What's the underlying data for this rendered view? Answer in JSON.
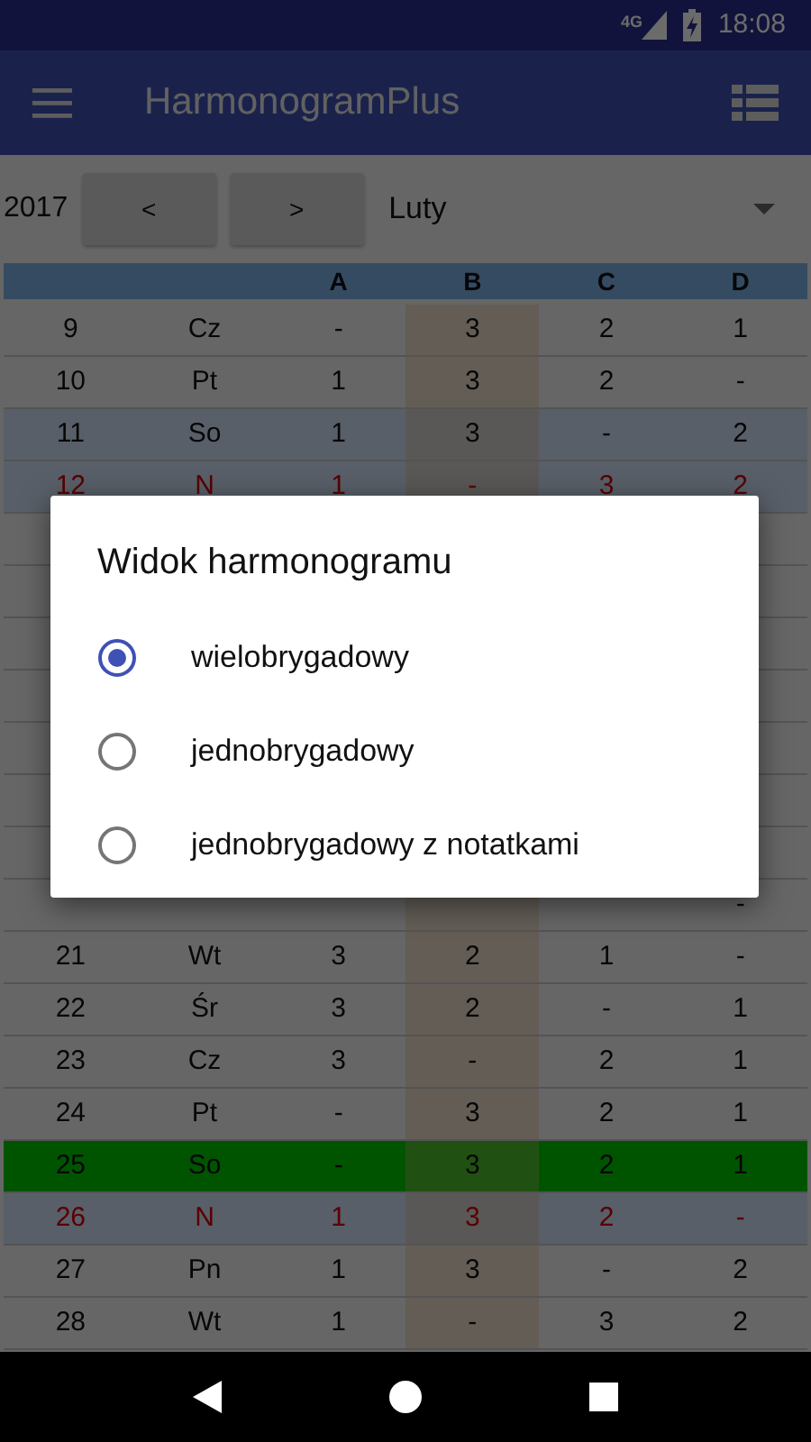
{
  "status_bar": {
    "network": "4G",
    "time": "18:08"
  },
  "app_bar": {
    "title": "HarmonogramPlus"
  },
  "controls": {
    "year": "2017",
    "prev": "<",
    "next": ">",
    "month": "Luty"
  },
  "table": {
    "columns": [
      "",
      "",
      "A",
      "B",
      "C",
      "D"
    ],
    "rows": [
      {
        "kind": "weekday",
        "cells": [
          "9",
          "Cz",
          "-",
          "3",
          "2",
          "1"
        ]
      },
      {
        "kind": "weekday",
        "cells": [
          "10",
          "Pt",
          "1",
          "3",
          "2",
          "-"
        ]
      },
      {
        "kind": "saturday",
        "cells": [
          "11",
          "So",
          "1",
          "3",
          "-",
          "2"
        ]
      },
      {
        "kind": "sunday",
        "cells": [
          "12",
          "N",
          "1",
          "-",
          "3",
          "2"
        ]
      },
      {
        "kind": "hidden"
      },
      {
        "kind": "hidden"
      },
      {
        "kind": "hidden"
      },
      {
        "kind": "hidden"
      },
      {
        "kind": "hidden"
      },
      {
        "kind": "hidden"
      },
      {
        "kind": "hidden"
      },
      {
        "kind": "weekday",
        "cells": [
          null,
          null,
          null,
          null,
          null,
          "-"
        ]
      },
      {
        "kind": "weekday",
        "cells": [
          "21",
          "Wt",
          "3",
          "2",
          "1",
          "-"
        ]
      },
      {
        "kind": "weekday",
        "cells": [
          "22",
          "Śr",
          "3",
          "2",
          "-",
          "1"
        ]
      },
      {
        "kind": "weekday",
        "cells": [
          "23",
          "Cz",
          "3",
          "-",
          "2",
          "1"
        ]
      },
      {
        "kind": "weekday",
        "cells": [
          "24",
          "Pt",
          "-",
          "3",
          "2",
          "1"
        ]
      },
      {
        "kind": "today",
        "cells": [
          "25",
          "So",
          "-",
          "3",
          "2",
          "1"
        ]
      },
      {
        "kind": "sunday",
        "cells": [
          "26",
          "N",
          "1",
          "3",
          "2",
          "-"
        ]
      },
      {
        "kind": "weekday",
        "cells": [
          "27",
          "Pn",
          "1",
          "3",
          "-",
          "2"
        ]
      },
      {
        "kind": "weekday",
        "cells": [
          "28",
          "Wt",
          "1",
          "-",
          "3",
          "2"
        ]
      }
    ]
  },
  "dialog": {
    "title": "Widok harmonogramu",
    "options": [
      {
        "label": "wielobrygadowy",
        "selected": true
      },
      {
        "label": "jednobrygadowy",
        "selected": false
      },
      {
        "label": "jednobrygadowy z notatkami",
        "selected": false
      }
    ]
  }
}
